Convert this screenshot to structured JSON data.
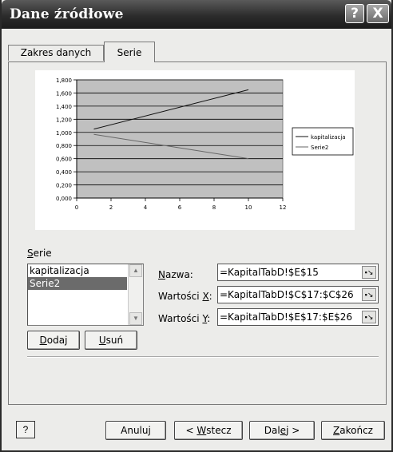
{
  "window": {
    "title": "Dane źródłowe"
  },
  "titlebar_buttons": {
    "help": "?",
    "close": "X"
  },
  "tabs": [
    {
      "label": "Zakres danych",
      "active": false
    },
    {
      "label": "Serie",
      "active": true
    }
  ],
  "chart_data": {
    "type": "line",
    "x": [
      1,
      10
    ],
    "series": [
      {
        "name": "kapitalizacja",
        "values": [
          1.05,
          1.65
        ],
        "color": "#111111"
      },
      {
        "name": "Serie2",
        "values": [
          0.97,
          0.6
        ],
        "color": "#666666"
      }
    ],
    "xlim": [
      0,
      12
    ],
    "ylim": [
      0,
      1.8
    ],
    "xticks": [
      "0",
      "2",
      "4",
      "6",
      "8",
      "10",
      "12"
    ],
    "yticks": [
      "0,000",
      "0,200",
      "0,400",
      "0,600",
      "0,800",
      "1,000",
      "1,200",
      "1,400",
      "1,600",
      "1,800"
    ],
    "grid": true,
    "plot_background": "#c0c0c0",
    "legend_position": "right"
  },
  "series_section": {
    "label": "Serie",
    "items": [
      "kapitalizacja",
      "Serie2"
    ],
    "selected_index": 1,
    "add_label": "Dodaj",
    "remove_label": "Usuń"
  },
  "fields": {
    "name_label": "Nazwa:",
    "name_value": "=KapitalTabD!$E$15",
    "x_label": "Wartości X:",
    "x_value": "=KapitalTabD!$C$17:$C$26",
    "y_label": "Wartości Y:",
    "y_value": "=KapitalTabD!$E$17:$E$26"
  },
  "footer": {
    "help_icon": "?",
    "cancel": "Anuluj",
    "back": "< Wstecz",
    "next": "Dalej >",
    "finish": "Zakończ"
  }
}
